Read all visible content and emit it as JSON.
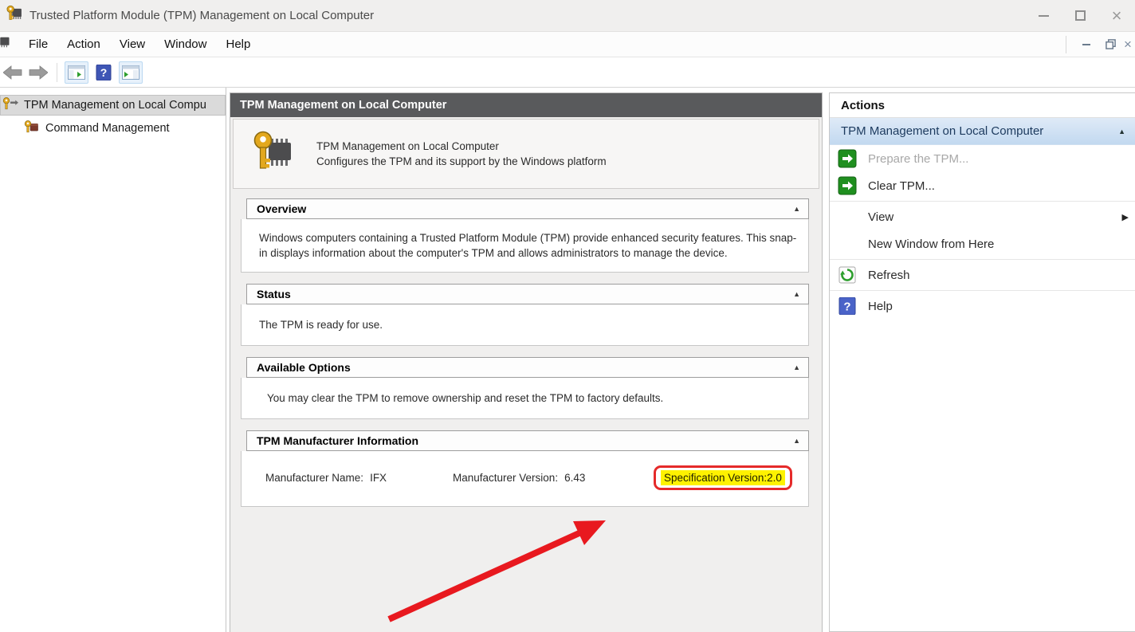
{
  "window": {
    "title": "Trusted Platform Module (TPM) Management on Local Computer"
  },
  "menu": {
    "items": [
      {
        "label": "File"
      },
      {
        "label": "Action"
      },
      {
        "label": "View"
      },
      {
        "label": "Window"
      },
      {
        "label": "Help"
      }
    ]
  },
  "tree": {
    "items": [
      {
        "label": "TPM Management on Local Compu",
        "selected": true
      },
      {
        "label": "Command Management",
        "selected": false
      }
    ]
  },
  "main": {
    "header": "TPM Management on Local Computer",
    "banner": {
      "title": "TPM Management on Local Computer",
      "subtitle": "Configures the TPM and its support by the Windows platform"
    },
    "sections": {
      "overview": {
        "title": "Overview",
        "body": "Windows computers containing a Trusted Platform Module (TPM) provide enhanced security features. This snap-in displays information about the computer's TPM and allows administrators to manage the device."
      },
      "status": {
        "title": "Status",
        "body": "The TPM is ready for use."
      },
      "available_options": {
        "title": "Available Options",
        "body": "You may clear the TPM to remove ownership and reset the TPM to factory defaults."
      },
      "manufacturer": {
        "title": "TPM Manufacturer Information",
        "name_label": "Manufacturer Name:",
        "name_value": "IFX",
        "version_label": "Manufacturer Version:",
        "version_value": "6.43",
        "spec_label": "Specification Version:",
        "spec_value": "2.0"
      }
    }
  },
  "actions": {
    "title": "Actions",
    "group_title": "TPM Management on Local Computer",
    "items": [
      {
        "label": "Prepare the TPM...",
        "disabled": true
      },
      {
        "label": "Clear TPM...",
        "disabled": false
      },
      {
        "label": "View",
        "submenu": true
      },
      {
        "label": "New Window from Here"
      },
      {
        "label": "Refresh"
      },
      {
        "label": "Help"
      }
    ]
  },
  "icons": {
    "collapse": "▲",
    "submenu": "▶",
    "help_glyph": "?",
    "minimize": "–",
    "close": "×"
  },
  "colors": {
    "highlight_yellow": "#fef200",
    "annotation_red": "#e8191f",
    "action_green": "#1f8f1f",
    "help_blue": "#4a63c8",
    "center_header_gray": "#595a5c",
    "group_header_blue": "#c2d9f0"
  }
}
